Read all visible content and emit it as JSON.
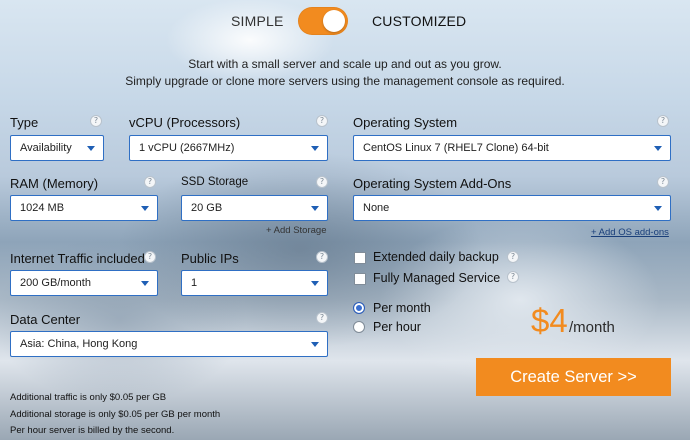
{
  "header": {
    "mode_simple": "SIMPLE",
    "mode_customized": "CUSTOMIZED",
    "toggle_state": "customized"
  },
  "intro": {
    "line1": "Start with a small server and scale up and out as you grow.",
    "line2": "Simply upgrade or clone more servers using the management console as required."
  },
  "fields": {
    "type": {
      "label": "Type",
      "value": "Availability"
    },
    "vcpu": {
      "label": "vCPU (Processors)",
      "value": "1 vCPU (2667MHz)"
    },
    "os": {
      "label": "Operating System",
      "value": "CentOS Linux 7 (RHEL7 Clone) 64-bit"
    },
    "ram": {
      "label": "RAM (Memory)",
      "value": "1024 MB"
    },
    "ssd": {
      "label": "SSD Storage",
      "value": "20 GB",
      "add_link": "+ Add Storage"
    },
    "os_addons": {
      "label": "Operating System Add-Ons",
      "value": "None",
      "add_link": "+ Add OS add-ons"
    },
    "traffic": {
      "label": "Internet Traffic included",
      "value": "200 GB/month"
    },
    "public_ips": {
      "label": "Public IPs",
      "value": "1"
    },
    "datacenter": {
      "label": "Data Center",
      "value": "Asia: China, Hong Kong"
    }
  },
  "options": {
    "backup": {
      "label": "Extended daily backup",
      "checked": false
    },
    "managed": {
      "label": "Fully Managed Service",
      "checked": false
    }
  },
  "billing": {
    "per_month": "Per month",
    "per_hour": "Per hour",
    "selected": "per_month"
  },
  "price": {
    "amount": "$4",
    "unit": "/month"
  },
  "create_button": "Create Server >>",
  "footnotes": [
    "Additional traffic is only $0.05 per GB",
    "Additional storage is only $0.05 per GB per month",
    "Per hour server is billed by the second."
  ],
  "help_glyph": "?",
  "colors": {
    "accent": "#f28b1f",
    "select_border": "#2f6fc4",
    "caret": "#1f5fb5"
  }
}
